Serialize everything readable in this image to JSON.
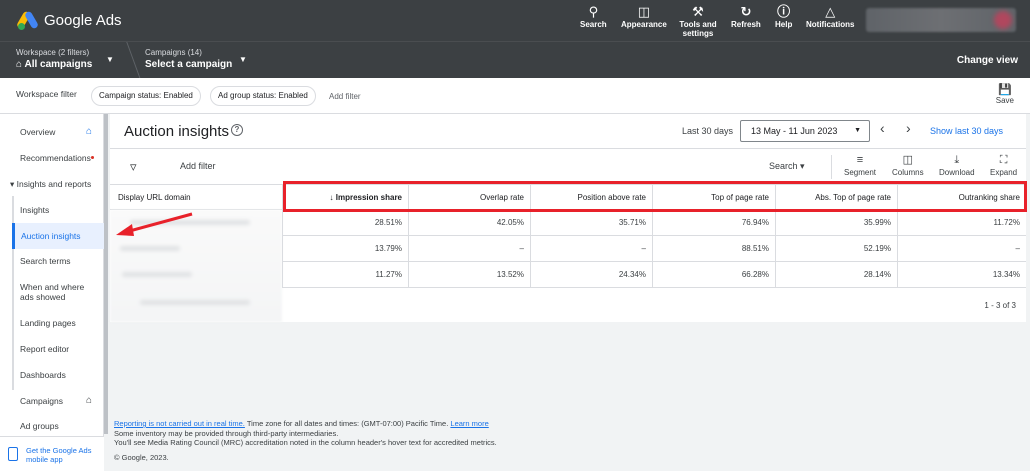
{
  "topbar": {
    "app_name": "Google Ads",
    "tools": [
      {
        "label": "Search",
        "icon": "search-icon"
      },
      {
        "label": "Appearance",
        "icon": "appearance-icon"
      },
      {
        "label": "Tools and settings",
        "icon": "wrench-icon"
      },
      {
        "label": "Refresh",
        "icon": "refresh-icon"
      },
      {
        "label": "Help",
        "icon": "help-icon"
      },
      {
        "label": "Notifications",
        "icon": "bell-icon"
      }
    ]
  },
  "workspace": {
    "workspace_small": "Workspace (2 filters)",
    "workspace_big": "All campaigns",
    "campaigns_small": "Campaigns (14)",
    "campaigns_big": "Select a campaign",
    "change_view": "Change view"
  },
  "filters": {
    "label": "Workspace filter",
    "chips": [
      "Campaign status: Enabled",
      "Ad group status: Enabled"
    ],
    "add_filter": "Add filter",
    "save": "Save"
  },
  "sidebar": {
    "items": [
      {
        "label": "Overview"
      },
      {
        "label": "Recommendations"
      },
      {
        "label": "Insights and reports"
      },
      {
        "label": "Insights"
      },
      {
        "label": "Auction insights"
      },
      {
        "label": "Search terms"
      },
      {
        "label": "When and where ads showed"
      },
      {
        "label": "Landing pages"
      },
      {
        "label": "Report editor"
      },
      {
        "label": "Dashboards"
      },
      {
        "label": "Campaigns"
      },
      {
        "label": "Ad groups"
      }
    ],
    "mobile_app": "Get the Google Ads mobile app"
  },
  "main": {
    "title": "Auction insights",
    "date_label": "Last 30 days",
    "date_range": "13 May - 11 Jun 2023",
    "show_last": "Show last 30 days",
    "add_filter": "Add filter",
    "search": "Search",
    "tools": [
      {
        "label": "Segment",
        "icon": "segment-icon"
      },
      {
        "label": "Columns",
        "icon": "columns-icon"
      },
      {
        "label": "Download",
        "icon": "download-icon"
      },
      {
        "label": "Expand",
        "icon": "expand-icon"
      }
    ]
  },
  "table": {
    "domain_header": "Display URL domain",
    "columns": [
      "Impression share",
      "Overlap rate",
      "Position above rate",
      "Top of page rate",
      "Abs. Top of page rate",
      "Outranking share"
    ],
    "rows": [
      [
        "28.51%",
        "42.05%",
        "35.71%",
        "76.94%",
        "35.99%",
        "11.72%"
      ],
      [
        "13.79%",
        "–",
        "–",
        "88.51%",
        "52.19%",
        "–"
      ],
      [
        "11.27%",
        "13.52%",
        "24.34%",
        "66.28%",
        "28.14%",
        "13.34%"
      ]
    ],
    "pager": "1 - 3 of 3"
  },
  "footer": {
    "link1": "Reporting is not carried out in real time.",
    "line1": " Time zone for all dates and times: (GMT-07:00) Pacific Time. ",
    "link2": "Learn more",
    "line2": "Some inventory may be provided through third-party intermediaries.",
    "line3": "You'll see Media Rating Council (MRC) accreditation noted in the column header's hover text for accredited metrics.",
    "copyright": "© Google, 2023."
  },
  "colors": {
    "topbar": "#3c4043",
    "accent": "#1a73e8",
    "annotation": "#e8212a"
  }
}
